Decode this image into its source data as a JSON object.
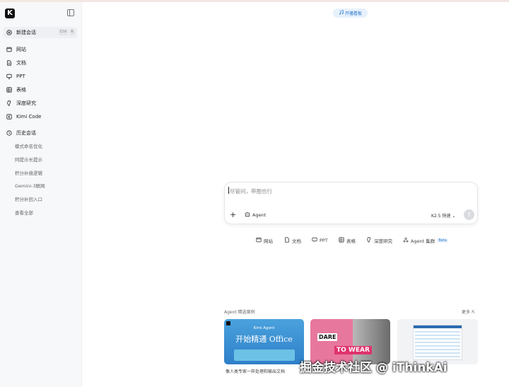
{
  "sidebar": {
    "logo": "K",
    "new_chat": "新建会话",
    "shortcut": [
      "Ctrl",
      "K"
    ],
    "nav": [
      {
        "label": "网站",
        "icon": "browser-icon"
      },
      {
        "label": "文档",
        "icon": "document-icon"
      },
      {
        "label": "PPT",
        "icon": "slides-icon"
      },
      {
        "label": "表格",
        "icon": "table-icon"
      },
      {
        "label": "深度研究",
        "icon": "research-icon"
      },
      {
        "label": "Kimi Code",
        "icon": "code-icon"
      }
    ],
    "history_label": "历史会话",
    "history": [
      "模式命名优化",
      "阿提示长提示",
      "积分补偿逻辑",
      "Gemini-3联网",
      "积分补回入口",
      "查看全部"
    ]
  },
  "top_badge": "开播看板",
  "input": {
    "placeholder": "尽管问，带图也行",
    "agent_label": "Agent",
    "model_label": "K2.5 快速"
  },
  "quick_actions": [
    {
      "label": "网站",
      "icon": "browser-icon"
    },
    {
      "label": "文档",
      "icon": "document-icon"
    },
    {
      "label": "PPT",
      "icon": "slides-icon"
    },
    {
      "label": "表格",
      "icon": "table-icon"
    },
    {
      "label": "深度研究",
      "icon": "research-icon"
    },
    {
      "label": "Agent 集群",
      "icon": "cluster-icon",
      "badge": "Beta"
    }
  ],
  "cases": {
    "title": "Agent 精选案例",
    "more": "更多",
    "cards": [
      {
        "line1": "Kimi Agent",
        "line2": "开始精通 Office"
      },
      {
        "line1": "DARE",
        "line2": "TO WEAR"
      },
      {
        "line1": ""
      }
    ],
    "caption": "像人类专家一样处理和输出文档"
  },
  "watermark": "掘金技术社区 @ iThinkAi"
}
